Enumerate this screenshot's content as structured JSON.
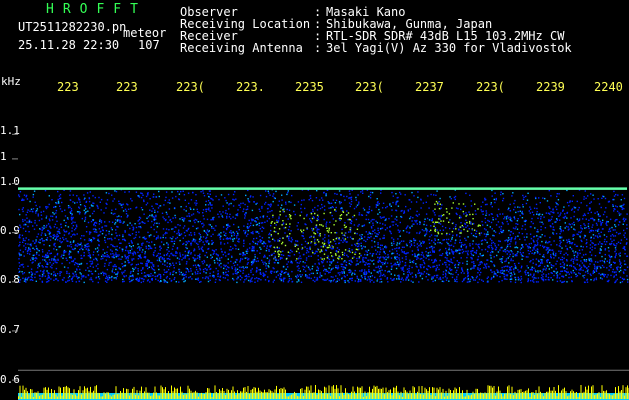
{
  "header": {
    "app_name": "HROFFT",
    "filename": "UT2511282230.pn",
    "mode": "meteor",
    "datetime": "25.11.28 22:30",
    "count": "107"
  },
  "info": [
    {
      "label": "Observer",
      "value": "Masaki Kano"
    },
    {
      "label": "Receiving Location",
      "value": "Shibukawa, Gunma, Japan"
    },
    {
      "label": "Receiver",
      "value": "RTL-SDR SDR# 43dB L15 103.2MHz CW"
    },
    {
      "label": "Receiving Antenna",
      "value": "3el Yagi(V) Az 330 for Vladivostok"
    }
  ],
  "chart_data": {
    "type": "heatmap",
    "ylabel": "kHz",
    "x_tick_labels": [
      "223",
      "223",
      "223(",
      "223.",
      "2235",
      "223(",
      "2237",
      "223(",
      "2239",
      "2240"
    ],
    "y_tick_labels": [
      "1.1",
      "1",
      "1.0",
      "0.9",
      "0.8",
      "0.7",
      "0.6"
    ],
    "y_ticks": [
      1.1,
      1.05,
      1.0,
      0.9,
      0.8,
      0.7,
      0.6
    ],
    "ylim": [
      0.59,
      1.18
    ],
    "signal_line_khz": 0.99,
    "noise_band_khz": [
      0.8,
      0.99
    ],
    "reference_line_khz": 0.62,
    "colors": {
      "background": "#000000",
      "signal_line": "#66ffaa",
      "noise_low": "#0022ff",
      "noise_mid": "#00aaff",
      "noise_high": "#aaff33",
      "tick_labels": "#ffff55",
      "baseline_bars": "#ffff00",
      "baseline_fill": "#00ccff"
    }
  }
}
